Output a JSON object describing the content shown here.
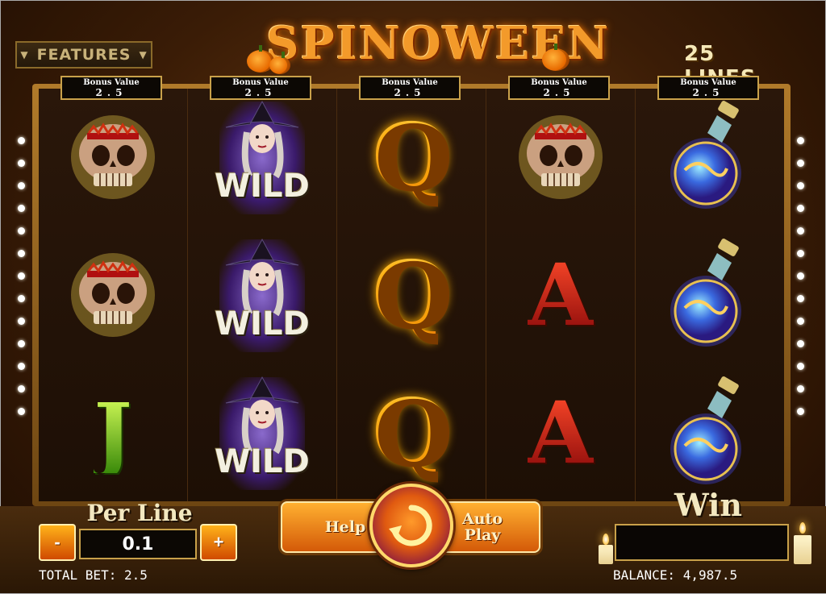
{
  "header": {
    "features_label": "FEATURES",
    "logo_text": "SPINOWEEN",
    "lines_label": "25 LINES"
  },
  "bonus_boxes": [
    {
      "label": "Bonus Value",
      "value": "2.5"
    },
    {
      "label": "Bonus Value",
      "value": "2.5"
    },
    {
      "label": "Bonus Value",
      "value": "2.5"
    },
    {
      "label": "Bonus Value",
      "value": "2.5"
    },
    {
      "label": "Bonus Value",
      "value": "2.5"
    }
  ],
  "reels": [
    [
      "skull",
      "skull",
      "J"
    ],
    [
      "WILD",
      "WILD",
      "WILD"
    ],
    [
      "Q",
      "Q",
      "Q"
    ],
    [
      "skull",
      "A",
      "A"
    ],
    [
      "potion",
      "potion",
      "potion"
    ]
  ],
  "controls": {
    "per_line_label": "Per Line",
    "per_line_value": "0.1",
    "minus_label": "-",
    "plus_label": "+",
    "help_label": "Help",
    "autoplay_label": "Auto Play",
    "spin_icon": "spin-arrow-icon"
  },
  "win": {
    "label": "Win",
    "value": ""
  },
  "status": {
    "total_bet": "TOTAL BET: 2.5",
    "balance": "BALANCE: 4,987.5"
  }
}
